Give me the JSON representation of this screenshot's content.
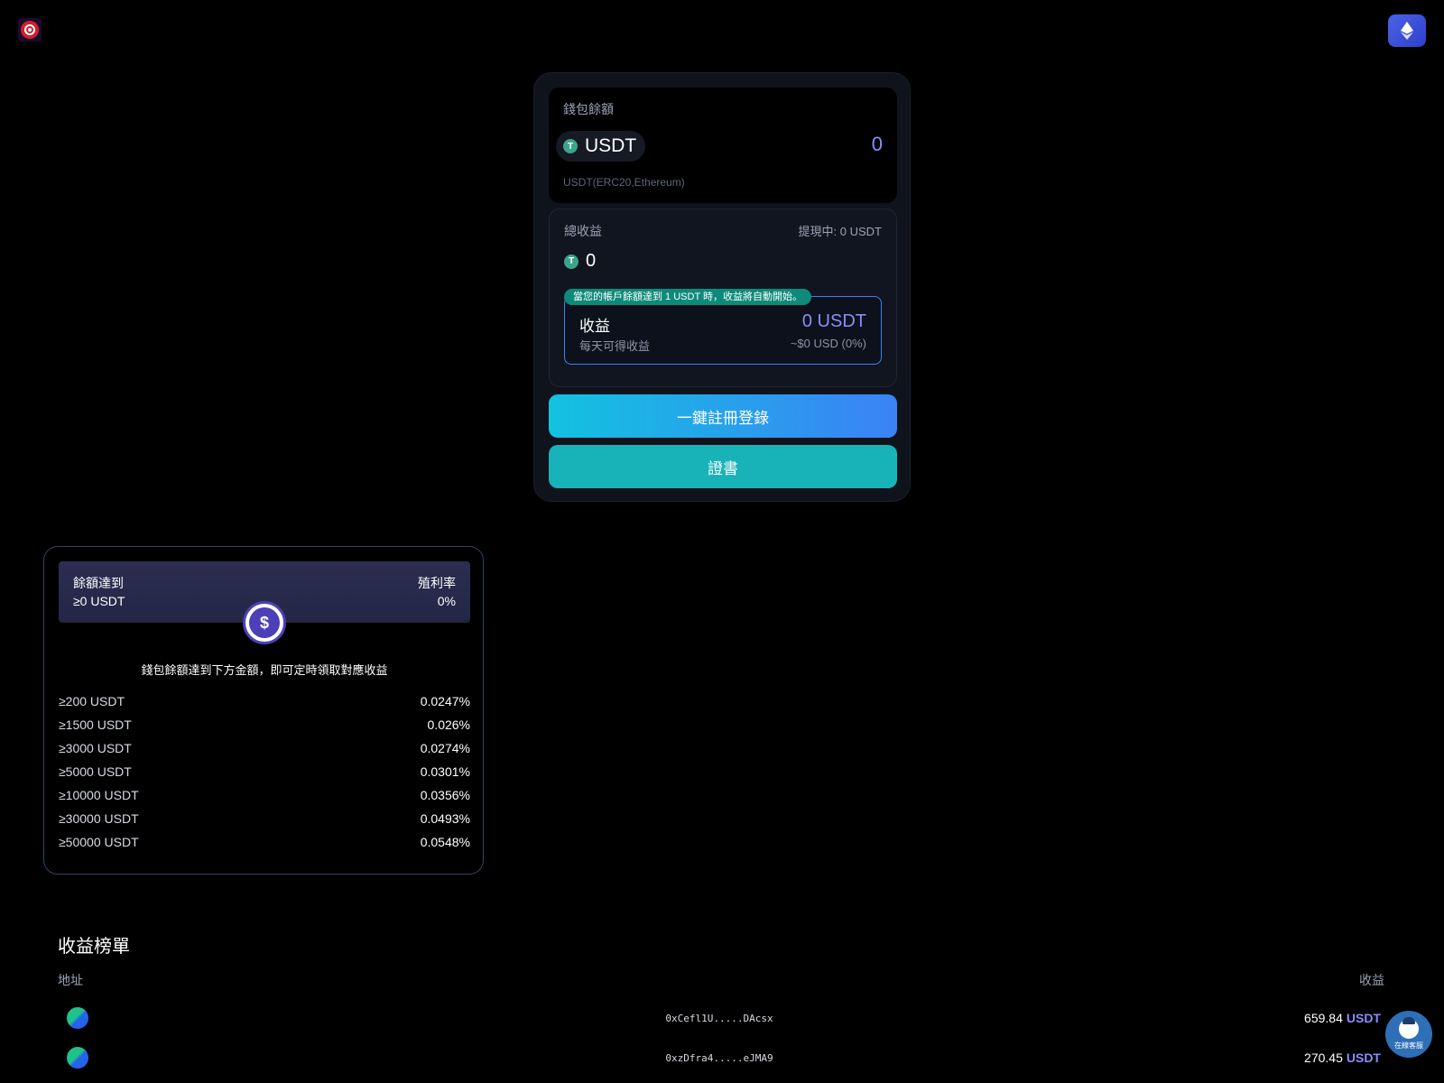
{
  "header": {
    "logo_icon": "record-icon",
    "network_icon": "ethereum-icon"
  },
  "wallet": {
    "title": "錢包餘額",
    "token": "USDT",
    "amount": "0",
    "network": "USDT(ERC20,Ethereum)"
  },
  "earnings": {
    "title": "總收益",
    "withdrawing": "提現中: 0 USDT",
    "total": "0",
    "notice": "當您的帳戶餘額達到 1 USDT 時，收益將自動開始。",
    "yield_label": "收益",
    "yield_sub": "每天可得收益",
    "yield_amount": "0 USDT",
    "yield_usd": "~$0 USD (0%)"
  },
  "actions": {
    "register_label": "一鍵註冊登錄",
    "certificate_label": "證書"
  },
  "rates": {
    "balance_label": "餘額達到",
    "balance_value": "≥0 USDT",
    "rate_label": "殖利率",
    "rate_value": "0%",
    "description": "錢包餘額達到下方金額，即可定時領取對應收益",
    "tiers": [
      {
        "threshold": "≥200 USDT",
        "rate": "0.0247%"
      },
      {
        "threshold": "≥1500 USDT",
        "rate": "0.026%"
      },
      {
        "threshold": "≥3000 USDT",
        "rate": "0.0274%"
      },
      {
        "threshold": "≥5000 USDT",
        "rate": "0.0301%"
      },
      {
        "threshold": "≥10000 USDT",
        "rate": "0.0356%"
      },
      {
        "threshold": "≥30000 USDT",
        "rate": "0.0493%"
      },
      {
        "threshold": "≥50000 USDT",
        "rate": "0.0548%"
      }
    ]
  },
  "leaderboard": {
    "title": "收益榜單",
    "col_address": "地址",
    "col_earnings": "收益",
    "rows": [
      {
        "address": "0xCefl1U.....DAcsx",
        "amount": "659.84",
        "unit": "USDT"
      },
      {
        "address": "0xzDfra4.....eJMA9",
        "amount": "270.45",
        "unit": "USDT"
      }
    ]
  },
  "support": {
    "label": "在線客服"
  },
  "colors": {
    "accent": "#8b8dfc",
    "primary_gradient_start": "#12c2e0",
    "primary_gradient_end": "#3b82f6",
    "secondary": "#18b3b8",
    "notice": "#0d8a7a"
  }
}
